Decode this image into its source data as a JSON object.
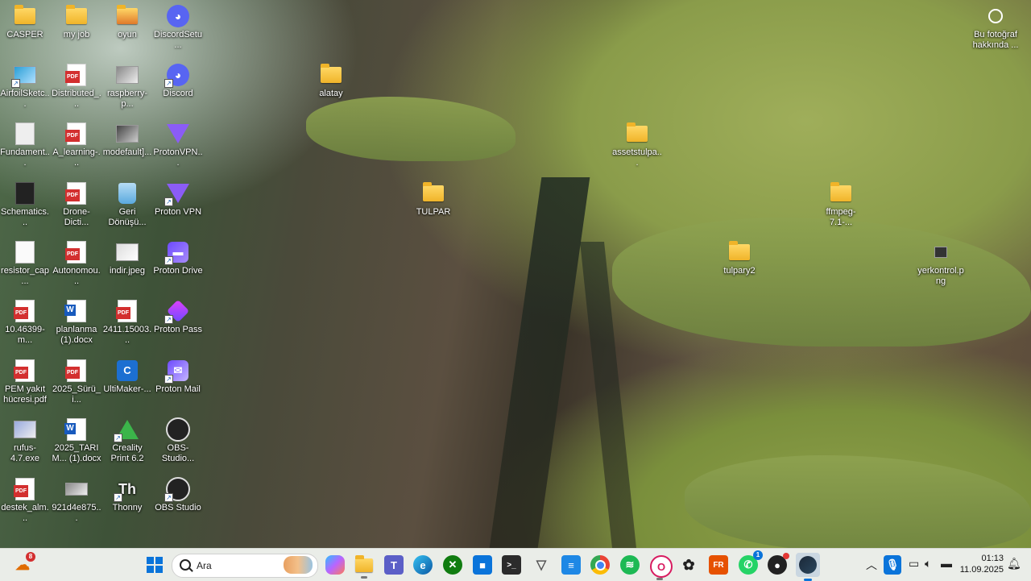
{
  "desktop": {
    "icons_col1": [
      "CASPER",
      "AirfoilSketc...",
      "Fundament...",
      "Schematics...",
      "resistor_cap...",
      "10.46399-m...",
      "PEM yakıt hücresi.pdf",
      "rufus-4.7.exe",
      "destek_alm..."
    ],
    "icons_col2": [
      "my job",
      "Distributed_...",
      "A_learning-...",
      "Drone-Dicti...",
      "Autonomou...",
      "planlanma (1).docx",
      "2025_Sürü_i...",
      "2025_TARIM... (1).docx",
      "921d4e875..."
    ],
    "icons_col3": [
      "oyun",
      "raspberry-p...",
      "modefault]...",
      "Geri Dönüşü...",
      "indir.jpeg",
      "2411.15003...",
      "UltiMaker-...",
      "Creality Print 6.2",
      "Thonny"
    ],
    "icons_col4": [
      "DiscordSetu...",
      "Discord",
      "ProtonVPN...",
      "Proton VPN",
      "Proton Drive",
      "Proton Pass",
      "Proton Mail",
      "OBS-Studio...",
      "OBS Studio"
    ],
    "scattered": {
      "alatay": "alatay",
      "assetstulpa": "assetstulpa...",
      "tulpar": "TULPAR",
      "ffmpeg": "ffmpeg-7.1-...",
      "tulpary2": "tulpary2",
      "yerkontrol": "yerkontrol.png"
    },
    "photo_info": "Bu fotoğraf hakkında ..."
  },
  "taskbar": {
    "search_placeholder": "Ara",
    "widgets_badge": "8",
    "whatsapp_badge": "1",
    "time": "01:13",
    "date": "11.09.2025"
  }
}
